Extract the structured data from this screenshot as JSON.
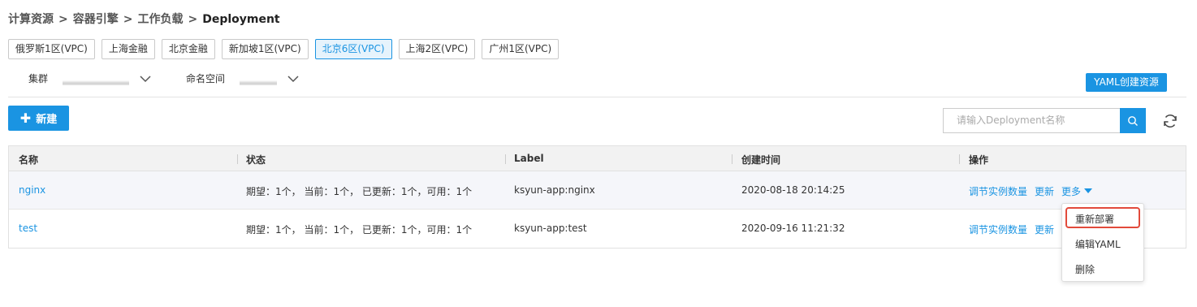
{
  "breadcrumb": {
    "items": [
      "计算资源",
      "容器引擎",
      "工作负载"
    ],
    "separator": ">",
    "current": "Deployment"
  },
  "regions": [
    {
      "label": "俄罗斯1区(VPC)",
      "active": false
    },
    {
      "label": "上海金融",
      "active": false
    },
    {
      "label": "北京金融",
      "active": false
    },
    {
      "label": "新加坡1区(VPC)",
      "active": false
    },
    {
      "label": "北京6区(VPC)",
      "active": true
    },
    {
      "label": "上海2区(VPC)",
      "active": false
    },
    {
      "label": "广州1区(VPC)",
      "active": false
    }
  ],
  "filters": {
    "cluster_label": "集群",
    "namespace_label": "命名空间"
  },
  "toolbar": {
    "yaml_create_label": "YAML创建资源",
    "new_label": "新建",
    "search_placeholder": "请输入Deployment名称"
  },
  "table": {
    "headers": [
      "名称",
      "状态",
      "Label",
      "创建时间",
      "操作"
    ],
    "rows": [
      {
        "name": "nginx",
        "status": "期望：1个， 当前：1个， 已更新：1个，可用：1个",
        "label": "ksyun-app:nginx",
        "created": "2020-08-18 20:14:25",
        "ops": {
          "scale": "调节实例数量",
          "update": "更新",
          "more": "更多"
        }
      },
      {
        "name": "test",
        "status": "期望：1个， 当前：1个， 已更新：1个，可用：1个",
        "label": "ksyun-app:test",
        "created": "2020-09-16 11:21:32",
        "ops": {
          "scale": "调节实例数量",
          "update": "更新"
        }
      }
    ]
  },
  "more_menu": {
    "items": [
      "重新部署",
      "编辑YAML",
      "删除"
    ],
    "highlighted": "重新部署"
  },
  "colors": {
    "accent": "#1a94e2",
    "highlight_border": "#e24a3b"
  }
}
